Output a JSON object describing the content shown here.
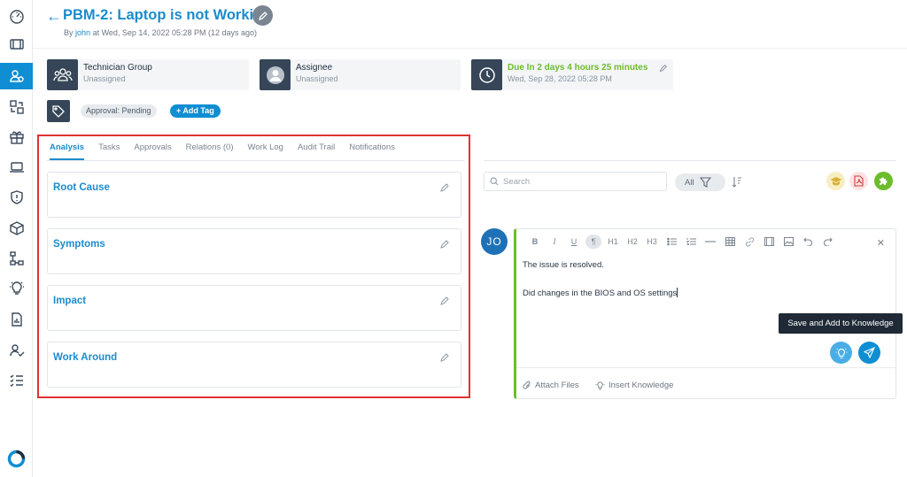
{
  "header": {
    "title": "PBM-2: Laptop is not Working",
    "by_label": "By",
    "author": "john",
    "at_text": "at Wed, Sep 14, 2022 05:28 PM (12 days ago)"
  },
  "cards": {
    "group": {
      "label": "Technician Group",
      "value": "Unassigned"
    },
    "assignee": {
      "label": "Assignee",
      "value": "Unassigned"
    },
    "due": {
      "label": "Due In 2 days 4 hours 25 minutes",
      "value": "Wed, Sep 28, 2022 05:28 PM"
    }
  },
  "tags": {
    "approval": "Approval: Pending",
    "add_tag": "+ Add Tag"
  },
  "tabs": [
    "Analysis",
    "Tasks",
    "Approvals",
    "Relations (0)",
    "Work Log",
    "Audit Trail",
    "Notifications"
  ],
  "analysis": [
    "Root Cause",
    "Symptoms",
    "Impact",
    "Work Around"
  ],
  "toolbar": {
    "search_placeholder": "Search",
    "filter_label": "All"
  },
  "editor": {
    "avatar": "JO",
    "tools": [
      "B",
      "I",
      "U",
      "¶",
      "H1",
      "H2",
      "H3"
    ],
    "line1": "The issue is resolved.",
    "line2": "Did changes in the BIOS and OS settings",
    "attach": "Attach Files",
    "insert": "Insert Knowledge",
    "tooltip": "Save and Add to Knowledge"
  },
  "colors": {
    "accent": "#1c8ccc",
    "due": "#6cbd2b",
    "highlight": "#e03232"
  }
}
